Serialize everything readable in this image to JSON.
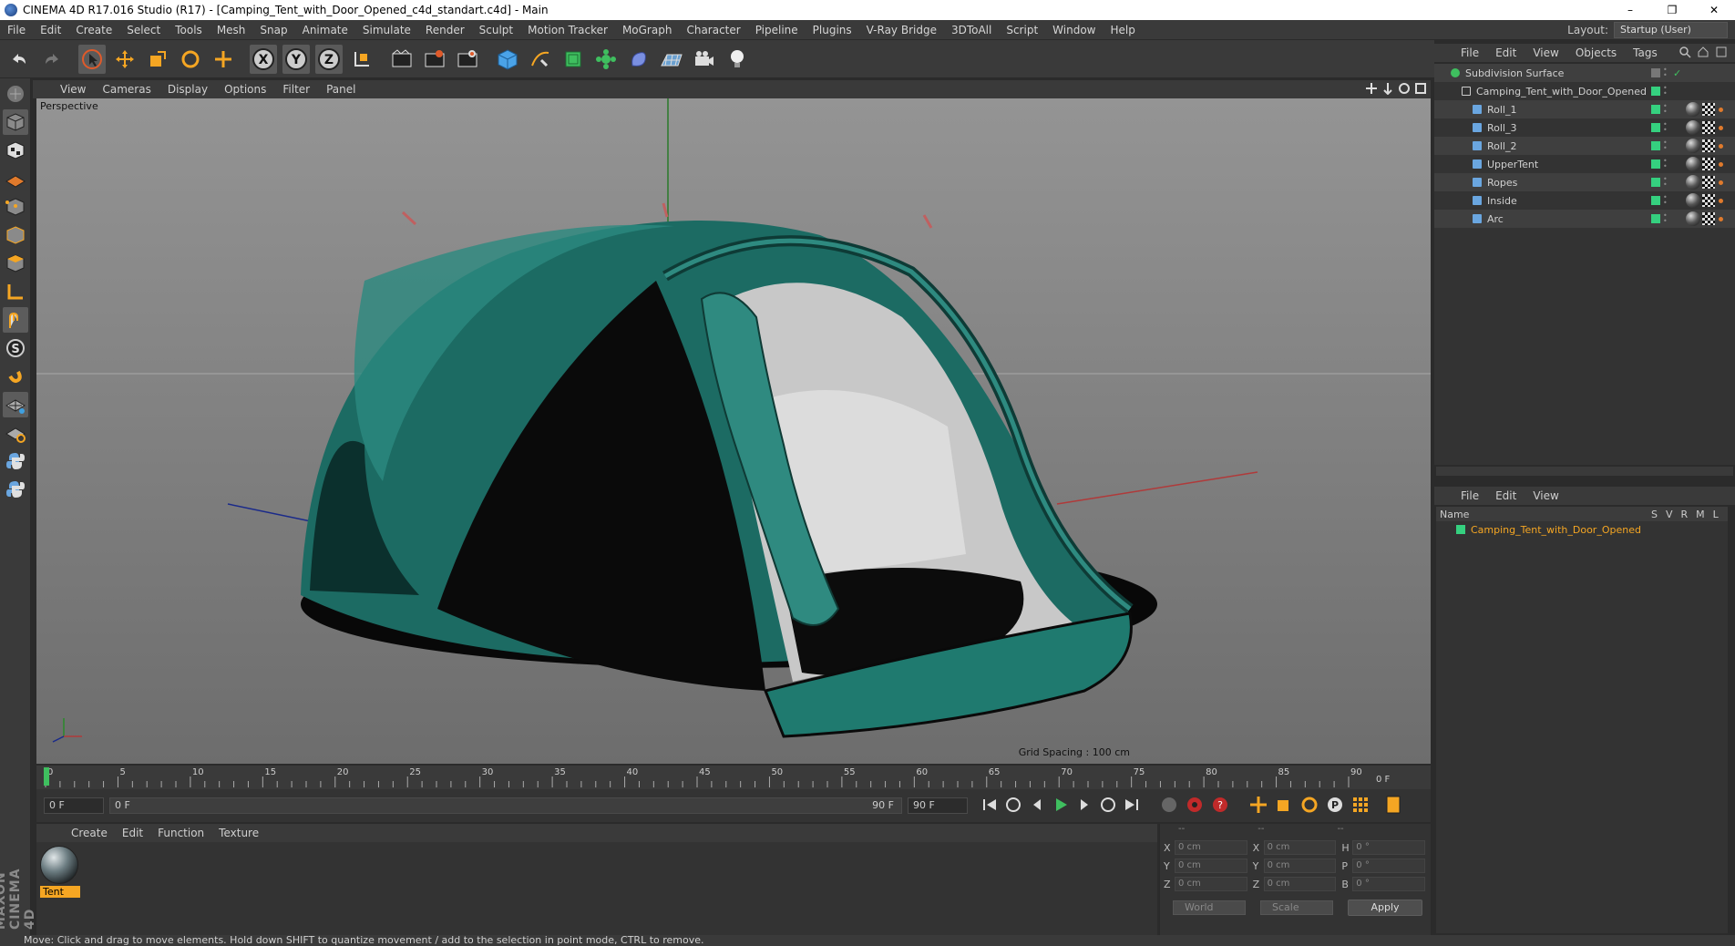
{
  "window": {
    "title": "CINEMA 4D R17.016 Studio (R17) - [Camping_Tent_with_Door_Opened_c4d_standart.c4d] - Main",
    "controls": [
      "–",
      "❐",
      "✕"
    ]
  },
  "menubar": {
    "items": [
      "File",
      "Edit",
      "Create",
      "Select",
      "Tools",
      "Mesh",
      "Snap",
      "Animate",
      "Simulate",
      "Render",
      "Sculpt",
      "Motion Tracker",
      "MoGraph",
      "Character",
      "Pipeline",
      "Plugins",
      "V-Ray Bridge",
      "3DToAll",
      "Script",
      "Window",
      "Help"
    ],
    "layout_label": "Layout:",
    "layout_value": "Startup (User)"
  },
  "viewport": {
    "menu": [
      "View",
      "Cameras",
      "Display",
      "Options",
      "Filter",
      "Panel"
    ],
    "camera_label": "Perspective",
    "grid_spacing": "Grid Spacing : 100 cm"
  },
  "timeline": {
    "ticks": [
      "0",
      "5",
      "10",
      "15",
      "20",
      "25",
      "30",
      "35",
      "40",
      "45",
      "50",
      "55",
      "60",
      "65",
      "70",
      "75",
      "80",
      "85",
      "90"
    ],
    "current_frame": "0 F",
    "start_frame": "0 F",
    "range_start": "0 F",
    "range_end": "90 F",
    "end_frame": "90 F"
  },
  "material_manager": {
    "menu": [
      "Create",
      "Edit",
      "Function",
      "Texture"
    ],
    "materials": [
      {
        "name": "Tent"
      }
    ]
  },
  "coordinates": {
    "headers": [
      "--",
      "--",
      "--"
    ],
    "rows": [
      {
        "axis": "X",
        "pos": "0 cm",
        "axis2": "X",
        "size": "0 cm",
        "axis3": "H",
        "rot": "0 °"
      },
      {
        "axis": "Y",
        "pos": "0 cm",
        "axis2": "Y",
        "size": "0 cm",
        "axis3": "P",
        "rot": "0 °"
      },
      {
        "axis": "Z",
        "pos": "0 cm",
        "axis2": "Z",
        "size": "0 cm",
        "axis3": "B",
        "rot": "0 °"
      }
    ],
    "mode": "World",
    "transform": "Scale",
    "apply_label": "Apply"
  },
  "object_manager": {
    "menu": [
      "File",
      "Edit",
      "View",
      "Objects",
      "Tags"
    ],
    "objects": [
      {
        "name": "Subdivision Surface",
        "depth": 0
      },
      {
        "name": "Camping_Tent_with_Door_Opened",
        "depth": 1
      },
      {
        "name": "Roll_1",
        "depth": 2
      },
      {
        "name": "Roll_3",
        "depth": 2
      },
      {
        "name": "Roll_2",
        "depth": 2
      },
      {
        "name": "UpperTent",
        "depth": 2
      },
      {
        "name": "Ropes",
        "depth": 2
      },
      {
        "name": "Inside",
        "depth": 2
      },
      {
        "name": "Arc",
        "depth": 2
      }
    ]
  },
  "attribute_manager": {
    "menu": [
      "File",
      "Edit",
      "View"
    ],
    "col_name": "Name",
    "cols": [
      "S",
      "V",
      "R",
      "M",
      "L"
    ],
    "items": [
      {
        "name": "Camping_Tent_with_Door_Opened"
      }
    ]
  },
  "statusbar": {
    "text": "Move: Click and drag to move elements. Hold down SHIFT to quantize movement / add to the selection in point mode, CTRL to remove."
  },
  "branding": {
    "logo_text": "MAXON CINEMA 4D"
  },
  "colors": {
    "accent_orange": "#f5a623",
    "tent_teal": "#1f7a6f",
    "object_green": "#35d07f"
  }
}
